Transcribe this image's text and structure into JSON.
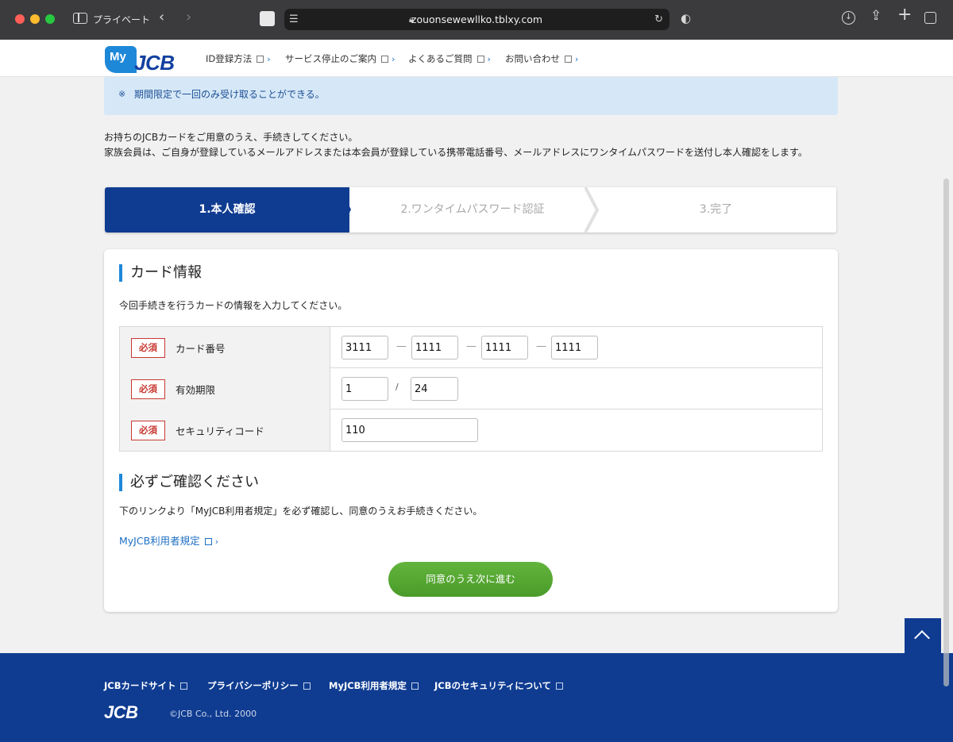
{
  "browser": {
    "private_label": "プライベート",
    "url": "zouonsewewllko.tblxy.com"
  },
  "header": {
    "logo_my": "My",
    "logo_jcb": "JCB",
    "nav": [
      {
        "label": "ID登録方法"
      },
      {
        "label": "サービス停止のご案内"
      },
      {
        "label": "よくあるご質問"
      },
      {
        "label": "お問い合わせ"
      }
    ]
  },
  "notice": {
    "mark": "※",
    "text": "期間限定で一回のみ受け取ることができる。"
  },
  "intro": {
    "line1": "お持ちのJCBカードをご用意のうえ、手続きしてください。",
    "line2": "家族会員は、ご自身が登録しているメールアドレスまたは本会員が登録している携帯電話番号、メールアドレスにワンタイムパスワードを送付し本人確認をします。"
  },
  "steps": [
    {
      "label": "1.本人確認"
    },
    {
      "label": "2.ワンタイムパスワード認証"
    },
    {
      "label": "3.完了"
    }
  ],
  "card_info": {
    "title": "カード情報",
    "desc": "今回手続きを行うカードの情報を入力してください。",
    "required_label": "必須",
    "card_number_label": "カード番号",
    "card_number": [
      "3111",
      "1111",
      "1111",
      "1111"
    ],
    "expiry_label": "有効期限",
    "expiry_month": "1",
    "expiry_sep": "/",
    "expiry_year": "24",
    "security_label": "セキュリティコード",
    "security_code": "110"
  },
  "confirm": {
    "title": "必ずご確認ください",
    "desc": "下のリンクより「MyJCB利用者規定」を必ず確認し、同意のうえお手続きください。",
    "link": "MyJCB利用者規定",
    "button": "同意のうえ次に進む"
  },
  "footer": {
    "links": [
      {
        "label": "JCBカードサイト"
      },
      {
        "label": "プライバシーポリシー"
      },
      {
        "label": "MyJCB利用者規定"
      },
      {
        "label": "JCBのセキュリティについて"
      }
    ],
    "logo": "JCB",
    "copyright": "©JCB Co., Ltd. 2000"
  },
  "colors": {
    "brand_blue": "#0f3c91",
    "accent_blue": "#1e88d8",
    "cta_green": "#55a531",
    "required_red": "#c83a32"
  }
}
